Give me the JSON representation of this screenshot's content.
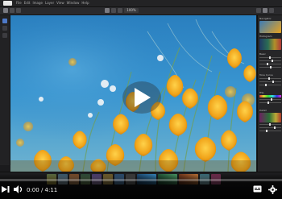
{
  "menubar": {
    "items": [
      "File",
      "Edit",
      "Image",
      "Layer",
      "View",
      "Window",
      "Help"
    ]
  },
  "toolbar": {
    "zoom_label": "100%"
  },
  "panel": {
    "sections": [
      "Navigator",
      "Histogram",
      "Basic",
      "Tone Curve",
      "HSL",
      "Detail"
    ]
  },
  "player": {
    "time": "0:00 / 4:11",
    "progress": 0.0,
    "accent": "#1f90ff"
  },
  "colors": {
    "sky": "#2d86c9",
    "flower": "#f0a319"
  }
}
